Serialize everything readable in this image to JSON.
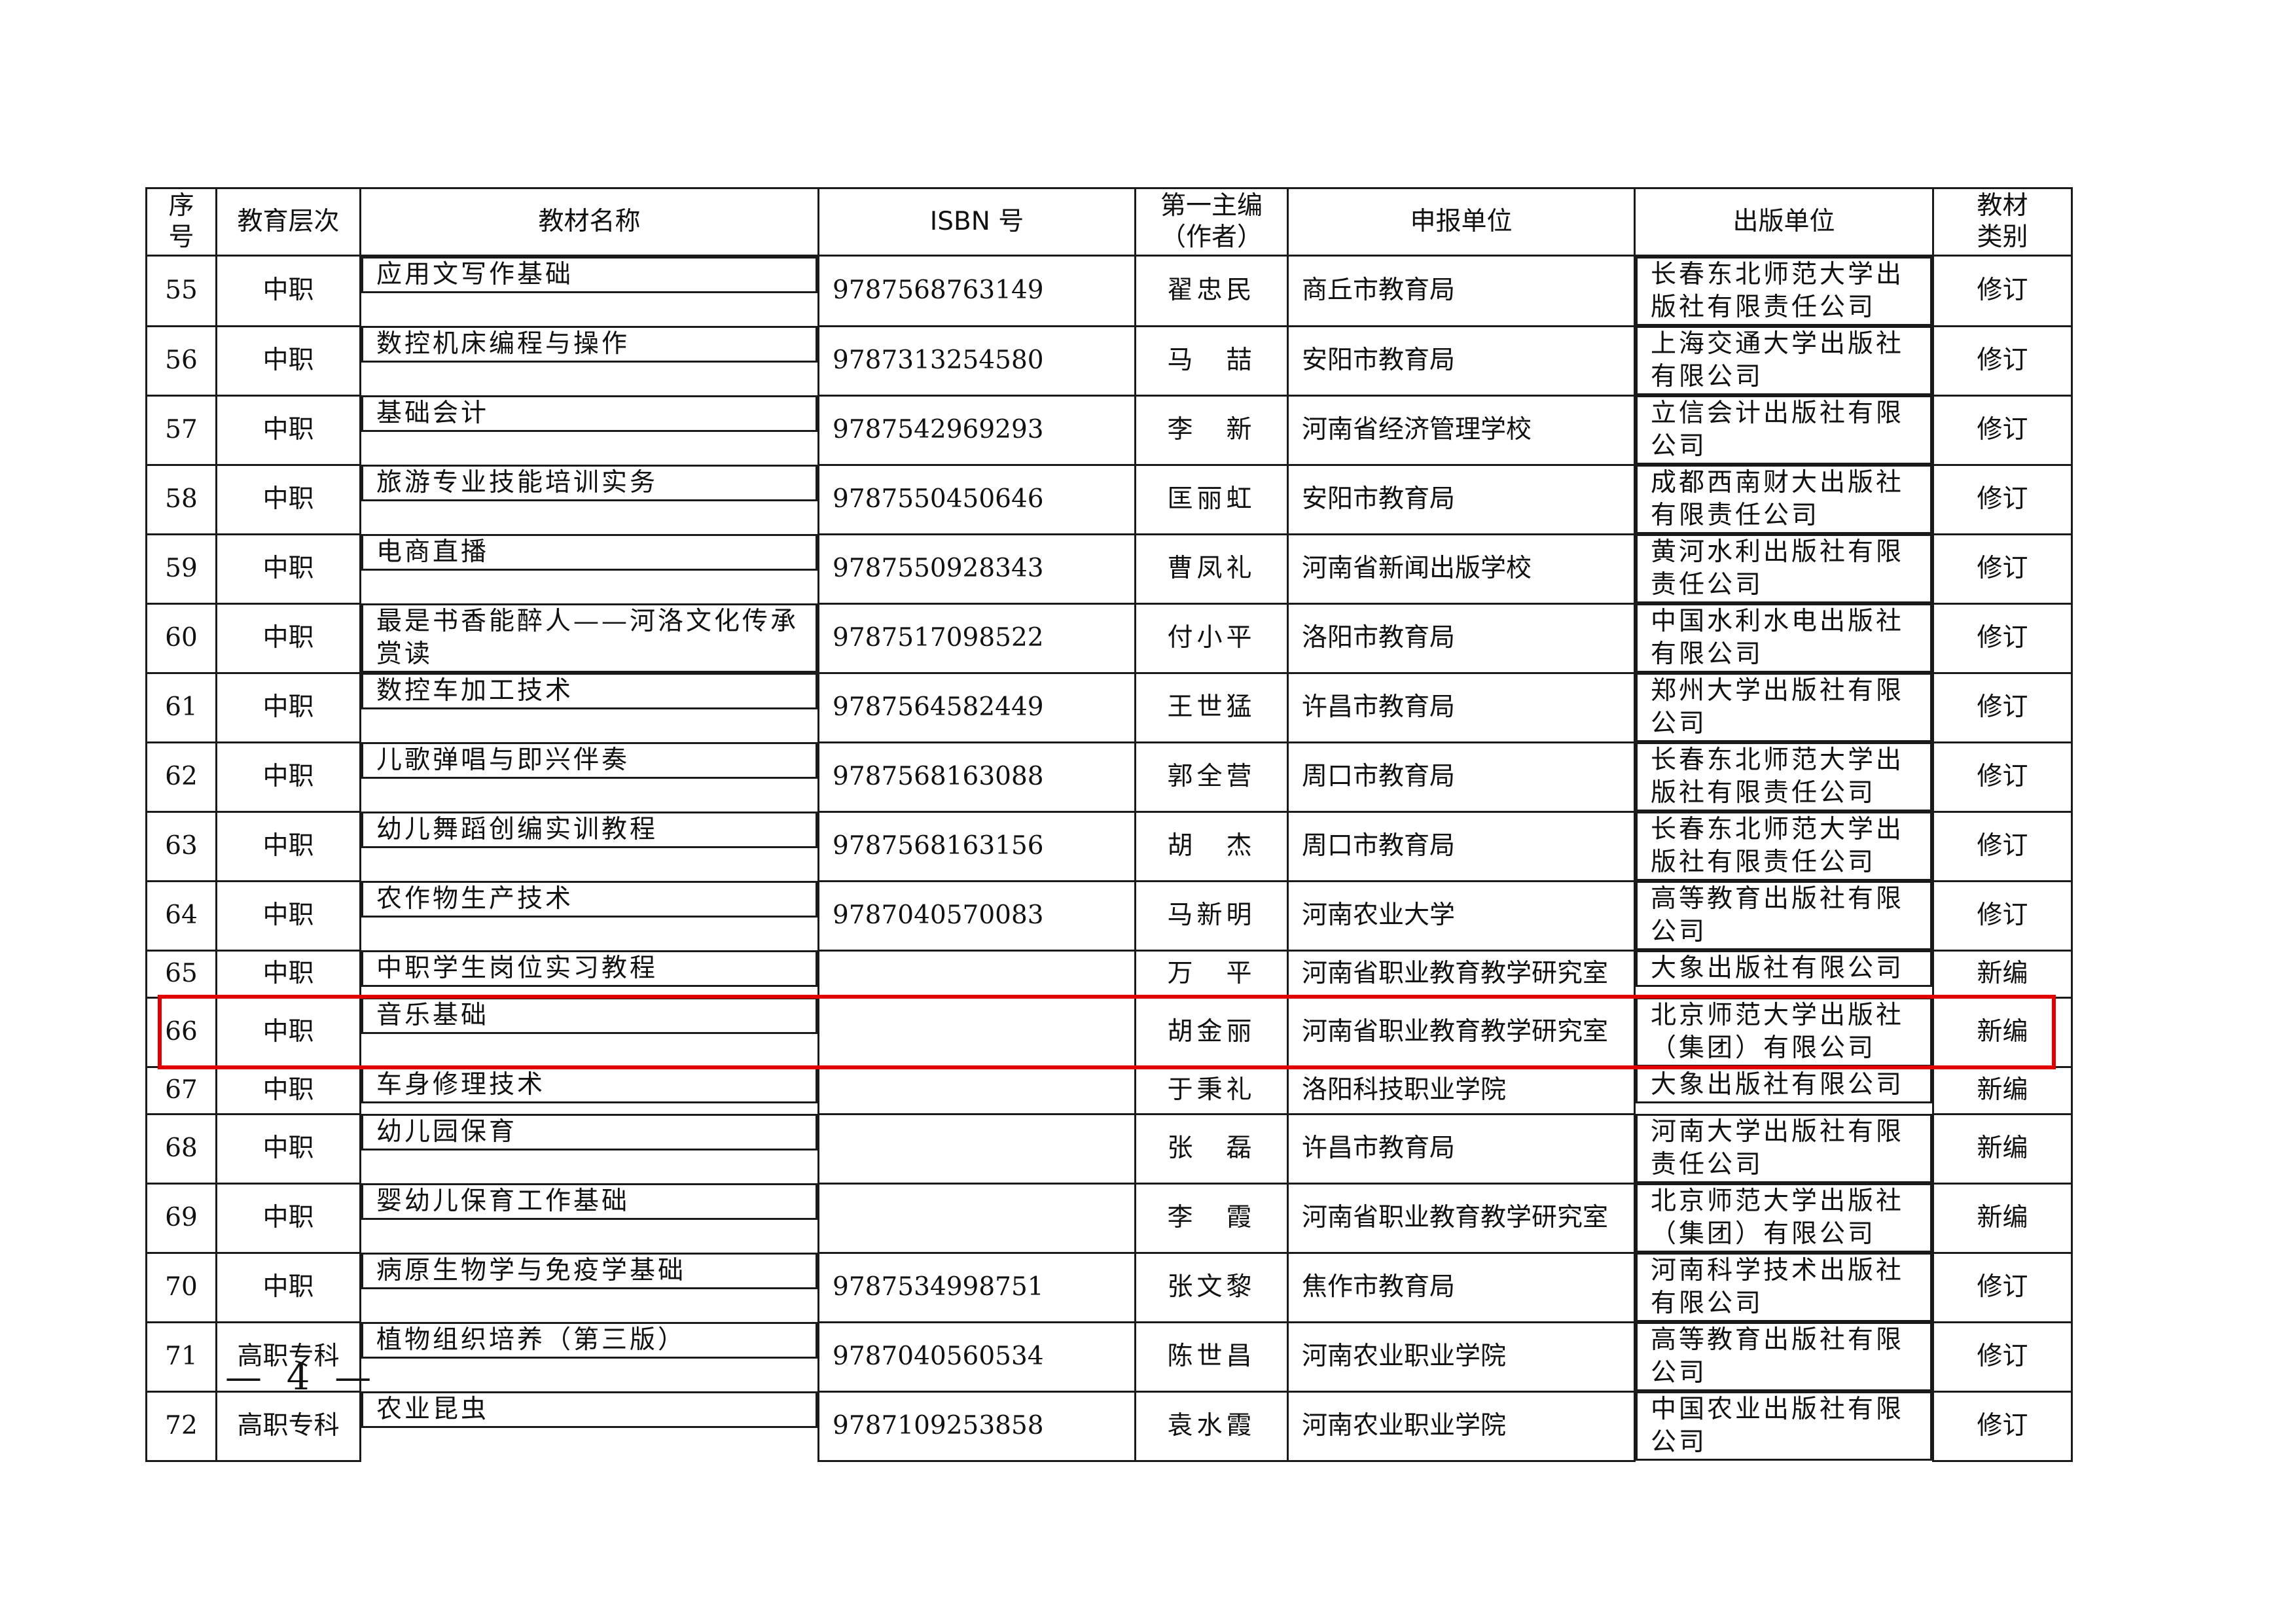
{
  "table": {
    "headers": {
      "seq": "序\n号",
      "level": "教育层次",
      "title": "教材名称",
      "isbn": "ISBN 号",
      "editor": "第一主编\n（作者）",
      "applicant": "申报单位",
      "publisher": "出版单位",
      "category": "教材\n类别"
    },
    "rows": [
      {
        "seq": "55",
        "level": "中职",
        "title": "应用文写作基础",
        "isbn": "9787568763149",
        "editor": "翟忠民",
        "applicant": "商丘市教育局",
        "publisher": "长春东北师范大学出版社有限责任公司",
        "category": "修订"
      },
      {
        "seq": "56",
        "level": "中职",
        "title": "数控机床编程与操作",
        "isbn": "9787313254580",
        "editor": "马　喆",
        "applicant": "安阳市教育局",
        "publisher": "上海交通大学出版社有限公司",
        "category": "修订"
      },
      {
        "seq": "57",
        "level": "中职",
        "title": "基础会计",
        "isbn": "9787542969293",
        "editor": "李　新",
        "applicant": "河南省经济管理学校",
        "publisher": "立信会计出版社有限公司",
        "category": "修订"
      },
      {
        "seq": "58",
        "level": "中职",
        "title": "旅游专业技能培训实务",
        "isbn": "9787550450646",
        "editor": "匡丽虹",
        "applicant": "安阳市教育局",
        "publisher": "成都西南财大出版社有限责任公司",
        "category": "修订"
      },
      {
        "seq": "59",
        "level": "中职",
        "title": "电商直播",
        "isbn": "9787550928343",
        "editor": "曹凤礼",
        "applicant": "河南省新闻出版学校",
        "publisher": "黄河水利出版社有限责任公司",
        "category": "修订"
      },
      {
        "seq": "60",
        "level": "中职",
        "title": "最是书香能醉人——河洛文化传承赏读",
        "isbn": "9787517098522",
        "editor": "付小平",
        "applicant": "洛阳市教育局",
        "publisher": "中国水利水电出版社有限公司",
        "category": "修订"
      },
      {
        "seq": "61",
        "level": "中职",
        "title": "数控车加工技术",
        "isbn": "9787564582449",
        "editor": "王世猛",
        "applicant": "许昌市教育局",
        "publisher": "郑州大学出版社有限公司",
        "category": "修订"
      },
      {
        "seq": "62",
        "level": "中职",
        "title": "儿歌弹唱与即兴伴奏",
        "isbn": "9787568163088",
        "editor": "郭全营",
        "applicant": "周口市教育局",
        "publisher": "长春东北师范大学出版社有限责任公司",
        "category": "修订"
      },
      {
        "seq": "63",
        "level": "中职",
        "title": "幼儿舞蹈创编实训教程",
        "isbn": "9787568163156",
        "editor": "胡　杰",
        "applicant": "周口市教育局",
        "publisher": "长春东北师范大学出版社有限责任公司",
        "category": "修订"
      },
      {
        "seq": "64",
        "level": "中职",
        "title": "农作物生产技术",
        "isbn": "9787040570083",
        "editor": "马新明",
        "applicant": "河南农业大学",
        "publisher": "高等教育出版社有限公司",
        "category": "修订"
      },
      {
        "seq": "65",
        "level": "中职",
        "title": "中职学生岗位实习教程",
        "isbn": "",
        "editor": "万　平",
        "applicant": "河南省职业教育教学研究室",
        "publisher": "大象出版社有限公司",
        "category": "新编"
      },
      {
        "seq": "66",
        "level": "中职",
        "title": "音乐基础",
        "isbn": "",
        "editor": "胡金丽",
        "applicant": "河南省职业教育教学研究室",
        "publisher": "北京师范大学出版社（集团）有限公司",
        "category": "新编"
      },
      {
        "seq": "67",
        "level": "中职",
        "title": "车身修理技术",
        "isbn": "",
        "editor": "于秉礼",
        "applicant": "洛阳科技职业学院",
        "publisher": "大象出版社有限公司",
        "category": "新编"
      },
      {
        "seq": "68",
        "level": "中职",
        "title": "幼儿园保育",
        "isbn": "",
        "editor": "张　磊",
        "applicant": "许昌市教育局",
        "publisher": "河南大学出版社有限责任公司",
        "category": "新编"
      },
      {
        "seq": "69",
        "level": "中职",
        "title": "婴幼儿保育工作基础",
        "isbn": "",
        "editor": "李　霞",
        "applicant": "河南省职业教育教学研究室",
        "publisher": "北京师范大学出版社（集团）有限公司",
        "category": "新编"
      },
      {
        "seq": "70",
        "level": "中职",
        "title": "病原生物学与免疫学基础",
        "isbn": "9787534998751",
        "editor": "张文黎",
        "applicant": "焦作市教育局",
        "publisher": "河南科学技术出版社有限公司",
        "category": "修订"
      },
      {
        "seq": "71",
        "level": "高职专科",
        "title": "植物组织培养（第三版）",
        "isbn": "9787040560534",
        "editor": "陈世昌",
        "applicant": "河南农业职业学院",
        "publisher": "高等教育出版社有限公司",
        "category": "修订"
      },
      {
        "seq": "72",
        "level": "高职专科",
        "title": "农业昆虫",
        "isbn": "9787109253858",
        "editor": "袁水霞",
        "applicant": "河南农业职业学院",
        "publisher": "中国农业出版社有限公司",
        "category": "修订"
      }
    ]
  },
  "highlight_color": "#e00000",
  "page_number": "— 4 —"
}
